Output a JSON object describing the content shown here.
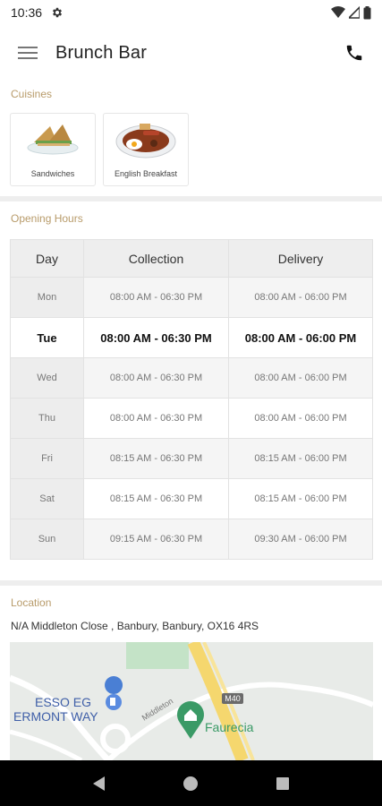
{
  "status_bar": {
    "time": "10:36"
  },
  "app_bar": {
    "title": "Brunch Bar"
  },
  "cuisines": {
    "label": "Cuisines",
    "items": [
      {
        "name": "Sandwiches"
      },
      {
        "name": "English Breakfast"
      }
    ]
  },
  "opening_hours": {
    "label": "Opening Hours",
    "headers": {
      "day": "Day",
      "collection": "Collection",
      "delivery": "Delivery"
    },
    "rows": [
      {
        "day": "Mon",
        "collection": "08:00 AM - 06:30 PM",
        "delivery": "08:00 AM - 06:00 PM"
      },
      {
        "day": "Tue",
        "collection": "08:00 AM - 06:30 PM",
        "delivery": "08:00 AM - 06:00 PM"
      },
      {
        "day": "Wed",
        "collection": "08:00 AM - 06:30 PM",
        "delivery": "08:00 AM - 06:00 PM"
      },
      {
        "day": "Thu",
        "collection": "08:00 AM - 06:30 PM",
        "delivery": "08:00 AM - 06:00 PM"
      },
      {
        "day": "Fri",
        "collection": "08:15 AM - 06:30 PM",
        "delivery": "08:15 AM - 06:00 PM"
      },
      {
        "day": "Sat",
        "collection": "08:15 AM - 06:30 PM",
        "delivery": "08:15 AM - 06:00 PM"
      },
      {
        "day": "Sun",
        "collection": "09:15 AM - 06:30 PM",
        "delivery": "09:30 AM - 06:00 PM"
      }
    ]
  },
  "location": {
    "label": "Location",
    "address": "N/A Middleton Close , Banbury, Banbury, OX16 4RS",
    "map": {
      "labels": {
        "esso1": "ESSO EG",
        "esso2": "ERMONT WAY",
        "road": "Middleton",
        "motorway": "M40",
        "poi": "Faurecia"
      }
    }
  },
  "colors": {
    "accent": "#b89b6a",
    "map_green": "#3a9a66",
    "road_yellow": "#f5d76e"
  }
}
